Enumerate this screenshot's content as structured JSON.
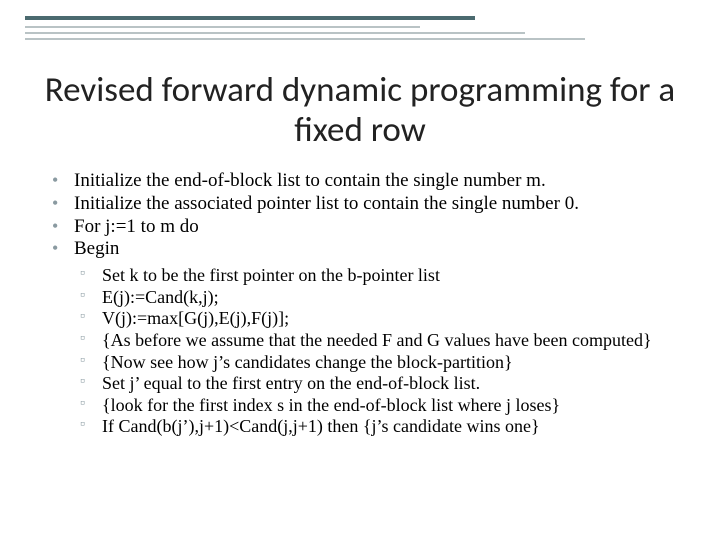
{
  "title": "Revised forward dynamic programming for a fixed row",
  "bullets_lvl1": [
    "Initialize the end-of-block list to contain the single number m.",
    "Initialize the associated pointer list to contain the single number 0.",
    "For j:=1 to m do",
    "Begin"
  ],
  "bullets_lvl2": [
    "Set k to be the first pointer on the b-pointer list",
    "E(j):=Cand(k,j);",
    "V(j):=max[G(j),E(j),F(j)];",
    "{As before we assume that the needed F and G values have been computed}",
    "{Now see how j’s candidates change the block-partition}",
    "Set j’ equal to the first entry on the end-of-block list.",
    "{look for the first index s in the end-of-block list where j loses}",
    "If Cand(b(j’),j+1)<Cand(j,j+1) then {j’s candidate wins one}"
  ]
}
